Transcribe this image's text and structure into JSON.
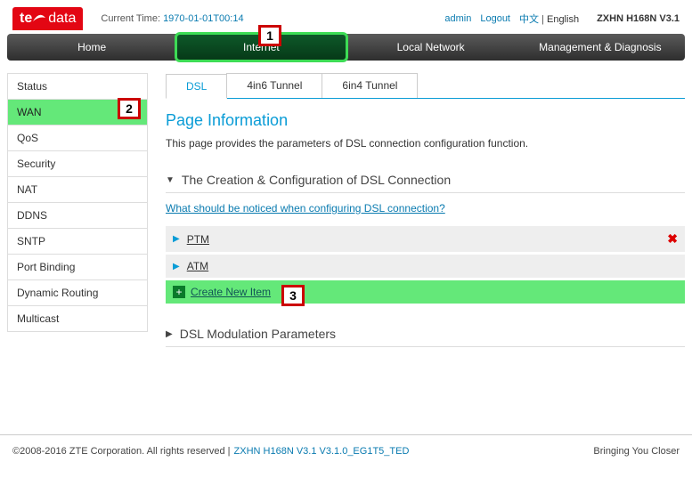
{
  "header": {
    "logo_prefix": "te",
    "logo_suffix": "data",
    "time_label": "Current Time: ",
    "time_value": "1970-01-01T00:14",
    "admin": "admin",
    "logout": "Logout",
    "lang_cn": "中文",
    "lang_sep": " | ",
    "lang_en": "English",
    "model": "ZXHN H168N V3.1"
  },
  "topnav": {
    "items": [
      "Home",
      "Internet",
      "Local Network",
      "Management & Diagnosis"
    ],
    "active_index": 1
  },
  "sidebar": {
    "items": [
      "Status",
      "WAN",
      "QoS",
      "Security",
      "NAT",
      "DDNS",
      "SNTP",
      "Port Binding",
      "Dynamic Routing",
      "Multicast"
    ],
    "active_index": 1
  },
  "tabs": {
    "items": [
      "DSL",
      "4in6 Tunnel",
      "6in4 Tunnel"
    ],
    "active_index": 0
  },
  "page": {
    "title": "Page Information",
    "desc": "This page provides the parameters of DSL connection configuration function."
  },
  "section1": {
    "title": "The Creation & Configuration of DSL Connection",
    "help_link": "What should be noticed when configuring DSL connection?",
    "rows": [
      "PTM",
      "ATM"
    ],
    "create_label": "Create New Item"
  },
  "section2": {
    "title": "DSL Modulation Parameters"
  },
  "callouts": {
    "c1": "1",
    "c2": "2",
    "c3": "3"
  },
  "footer": {
    "copyright": "©2008-2016 ZTE Corporation. All rights reserved  |  ",
    "model": "ZXHN H168N V3.1 V3.1.0_EG1T5_TED",
    "tagline": "Bringing You Closer"
  }
}
